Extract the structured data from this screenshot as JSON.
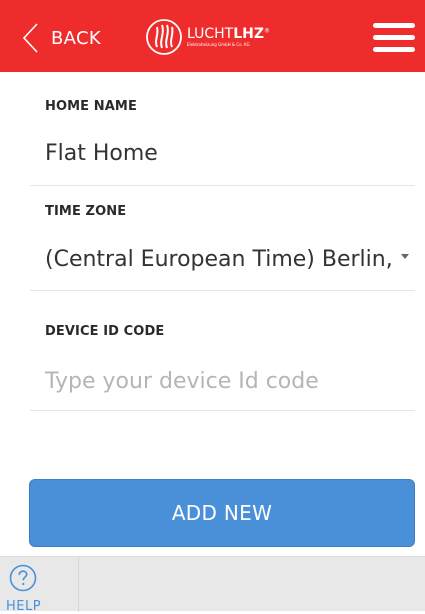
{
  "header": {
    "back_label": "BACK",
    "logo_brand_light": "LUCHT",
    "logo_brand_bold": "LHZ",
    "logo_reg": "®",
    "logo_subtitle": "Elektroheizung GmbH & Co. KG",
    "background_color": "#ee2c2c"
  },
  "form": {
    "home_name": {
      "label": "HOME NAME",
      "value": "Flat Home"
    },
    "time_zone": {
      "label": "TIME ZONE",
      "value": "(Central European Time) Berlin,"
    },
    "device_id": {
      "label": "DEVICE ID CODE",
      "placeholder": "Type your device Id code"
    },
    "submit_label": "ADD NEW"
  },
  "bottom_bar": {
    "help_label": "HELP"
  },
  "colors": {
    "accent": "#4a90d9",
    "header_red": "#ee2c2c"
  }
}
